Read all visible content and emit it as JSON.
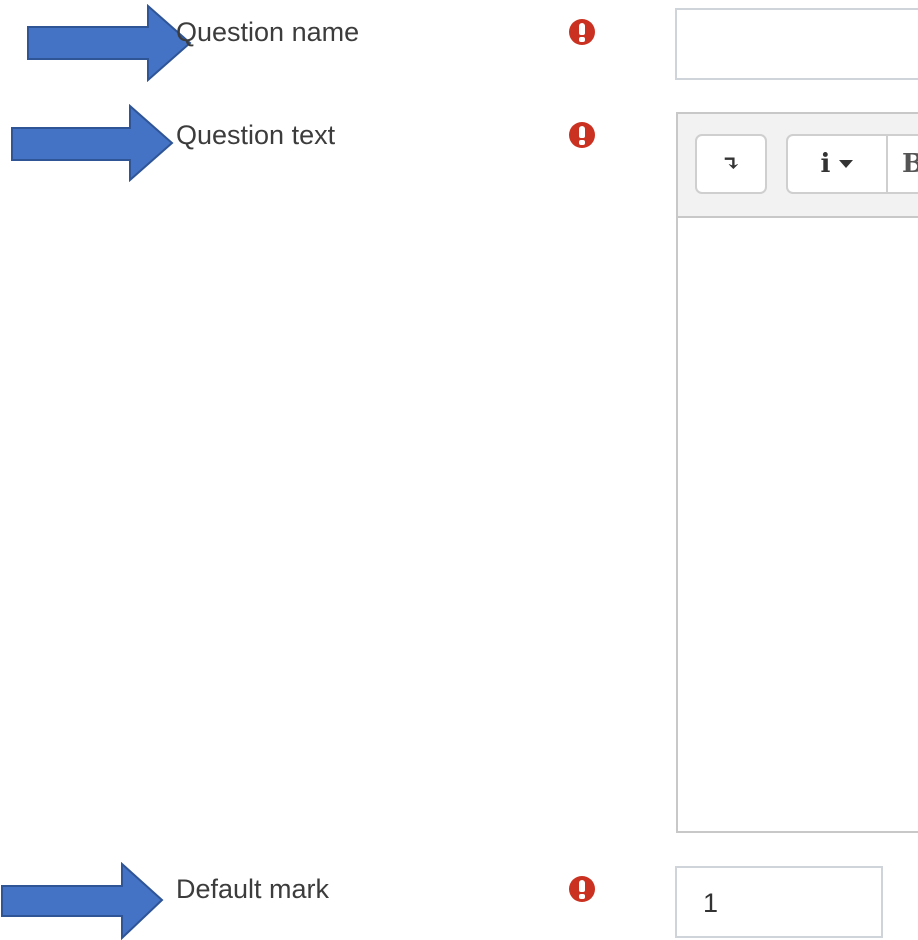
{
  "form": {
    "question_name": {
      "label": "Question name",
      "value": ""
    },
    "question_text": {
      "label": "Question text",
      "toolbar": [
        {
          "icon": "collapse-toolbar-icon",
          "glyph": "↴"
        },
        {
          "icon": "info-dropdown-icon",
          "glyph": "i"
        },
        {
          "icon": "bold-icon",
          "glyph": "B"
        }
      ]
    },
    "default_mark": {
      "label": "Default mark",
      "value": "1"
    }
  },
  "colors": {
    "required_icon": "#ca3120",
    "arrow_fill": "#4472c4",
    "arrow_stroke": "#2f5597"
  }
}
